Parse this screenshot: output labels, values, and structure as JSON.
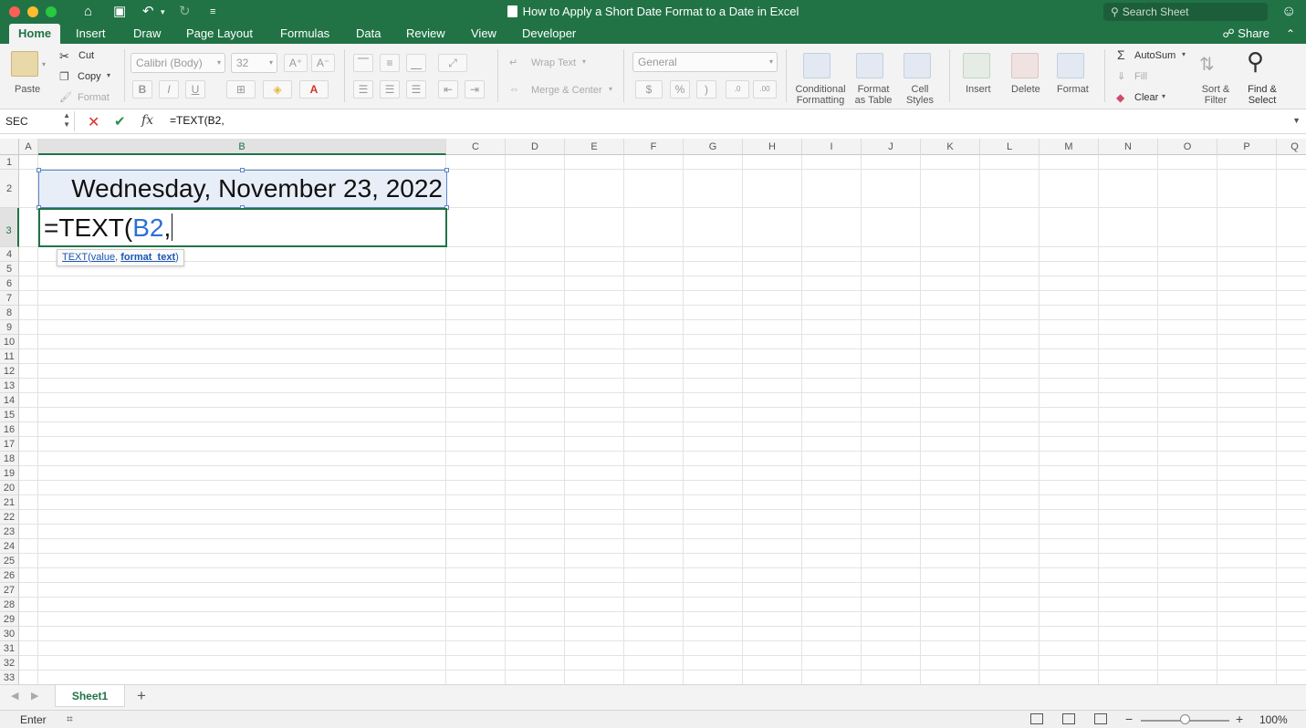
{
  "window": {
    "title": "How to Apply a Short Date Format to a Date in Excel",
    "search_placeholder": "Search Sheet"
  },
  "tabs": [
    "Home",
    "Insert",
    "Draw",
    "Page Layout",
    "Formulas",
    "Data",
    "Review",
    "View",
    "Developer"
  ],
  "active_tab": "Home",
  "share_label": "Share",
  "ribbon": {
    "clipboard": {
      "paste": "Paste",
      "cut": "Cut",
      "copy": "Copy",
      "format": "Format"
    },
    "font": {
      "name": "Calibri (Body)",
      "size": "32",
      "bold": "B",
      "italic": "I",
      "underline": "U"
    },
    "alignment": {
      "wrap_text": "Wrap Text",
      "merge_center": "Merge & Center"
    },
    "number": {
      "format": "General",
      "currency": "$",
      "percent": "%",
      "comma": ")"
    },
    "styles": {
      "conditional": "Conditional",
      "conditional2": "Formatting",
      "format_table": "Format",
      "format_table2": "as Table",
      "cell_styles": "Cell",
      "cell_styles2": "Styles"
    },
    "cells": {
      "insert": "Insert",
      "delete": "Delete",
      "format": "Format"
    },
    "editing": {
      "autosum": "AutoSum",
      "fill": "Fill",
      "clear": "Clear",
      "sort": "Sort &",
      "sort2": "Filter",
      "find": "Find &",
      "find2": "Select"
    }
  },
  "formula_bar": {
    "name_box": "SEC",
    "formula": "=TEXT(B2,"
  },
  "grid": {
    "columns": [
      "A",
      "B",
      "C",
      "D",
      "E",
      "F",
      "G",
      "H",
      "I",
      "J",
      "K",
      "L",
      "M",
      "N",
      "O",
      "P",
      "Q"
    ],
    "rows": [
      "1",
      "2",
      "3",
      "4",
      "5",
      "6",
      "7",
      "8",
      "9",
      "10",
      "11",
      "12",
      "13",
      "14",
      "15",
      "16",
      "17",
      "18",
      "19",
      "20",
      "21",
      "22",
      "23",
      "24",
      "25",
      "26",
      "27",
      "28",
      "29",
      "30",
      "31",
      "32",
      "33"
    ],
    "b2_value": "Wednesday, November 23, 2022",
    "b3_prefix": "=TEXT(",
    "b3_ref": "B2",
    "b3_suffix": ","
  },
  "tooltip": {
    "fn": "TEXT",
    "open": "(",
    "arg1": "value",
    "sep": ", ",
    "arg2": "format_text",
    "close": ")"
  },
  "sheets": [
    "Sheet1"
  ],
  "status": {
    "mode": "Enter",
    "zoom": "100%"
  },
  "colors": {
    "accent": "#217346",
    "ref_blue": "#2e6fd6",
    "selection_blue": "#5b87c7"
  }
}
